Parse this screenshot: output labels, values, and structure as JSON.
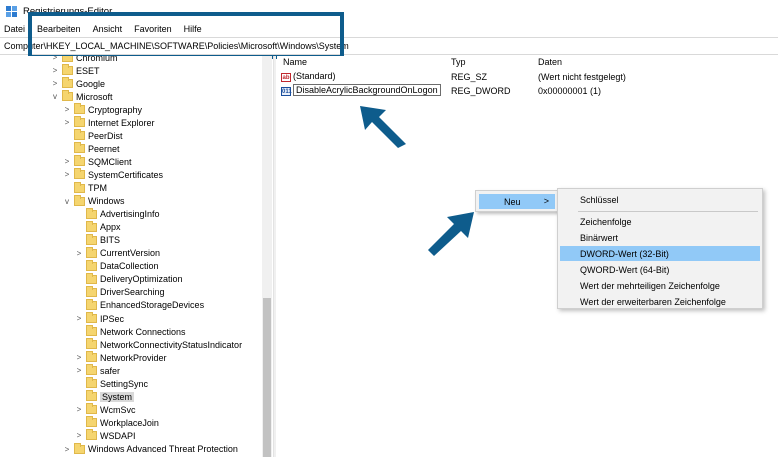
{
  "window": {
    "title": "Registrierungs-Editor"
  },
  "menubar": [
    "Datei",
    "Bearbeiten",
    "Ansicht",
    "Favoriten",
    "Hilfe"
  ],
  "address": {
    "path": "Computer\\HKEY_LOCAL_MACHINE\\SOFTWARE\\Policies\\Microsoft\\Windows\\System"
  },
  "tree": [
    {
      "label": "Chromium",
      "level": 1,
      "expand": ">"
    },
    {
      "label": "ESET",
      "level": 1,
      "expand": ">"
    },
    {
      "label": "Google",
      "level": 1,
      "expand": ">"
    },
    {
      "label": "Microsoft",
      "level": 1,
      "expand": "v"
    },
    {
      "label": "Cryptography",
      "level": 2,
      "expand": ">"
    },
    {
      "label": "Internet Explorer",
      "level": 2,
      "expand": ">"
    },
    {
      "label": "PeerDist",
      "level": 2,
      "expand": ""
    },
    {
      "label": "Peernet",
      "level": 2,
      "expand": ""
    },
    {
      "label": "SQMClient",
      "level": 2,
      "expand": ">"
    },
    {
      "label": "SystemCertificates",
      "level": 2,
      "expand": ">"
    },
    {
      "label": "TPM",
      "level": 2,
      "expand": ""
    },
    {
      "label": "Windows",
      "level": 2,
      "expand": "v"
    },
    {
      "label": "AdvertisingInfo",
      "level": 3,
      "expand": ""
    },
    {
      "label": "Appx",
      "level": 3,
      "expand": ""
    },
    {
      "label": "BITS",
      "level": 3,
      "expand": ""
    },
    {
      "label": "CurrentVersion",
      "level": 3,
      "expand": ">"
    },
    {
      "label": "DataCollection",
      "level": 3,
      "expand": ""
    },
    {
      "label": "DeliveryOptimization",
      "level": 3,
      "expand": ""
    },
    {
      "label": "DriverSearching",
      "level": 3,
      "expand": ""
    },
    {
      "label": "EnhancedStorageDevices",
      "level": 3,
      "expand": ""
    },
    {
      "label": "IPSec",
      "level": 3,
      "expand": ">"
    },
    {
      "label": "Network Connections",
      "level": 3,
      "expand": ""
    },
    {
      "label": "NetworkConnectivityStatusIndicator",
      "level": 3,
      "expand": ""
    },
    {
      "label": "NetworkProvider",
      "level": 3,
      "expand": ">"
    },
    {
      "label": "safer",
      "level": 3,
      "expand": ">"
    },
    {
      "label": "SettingSync",
      "level": 3,
      "expand": ""
    },
    {
      "label": "System",
      "level": 3,
      "expand": "",
      "selected": true
    },
    {
      "label": "WcmSvc",
      "level": 3,
      "expand": ">"
    },
    {
      "label": "WorkplaceJoin",
      "level": 3,
      "expand": ""
    },
    {
      "label": "WSDAPI",
      "level": 3,
      "expand": ">"
    },
    {
      "label": "Windows Advanced Threat Protection",
      "level": 2,
      "expand": ">"
    }
  ],
  "list": {
    "headers": {
      "name": "Name",
      "type": "Typ",
      "data": "Daten"
    },
    "rows": [
      {
        "icon": "ab",
        "name": "(Standard)",
        "type": "REG_SZ",
        "data": "(Wert nicht festgelegt)"
      },
      {
        "icon": "011",
        "name": "DisableAcrylicBackgroundOnLogon",
        "type": "REG_DWORD",
        "data": "0x00000001 (1)"
      }
    ]
  },
  "context_menu": {
    "neu": {
      "label": "Neu",
      "chevron": ">"
    },
    "submenu": [
      "Schlüssel",
      "Zeichenfolge",
      "Binärwert",
      "DWORD-Wert (32-Bit)",
      "QWORD-Wert (64-Bit)",
      "Wert der mehrteiligen Zeichenfolge",
      "Wert der erweiterbaren Zeichenfolge"
    ]
  },
  "colors": {
    "accent_box": "#0e5c8c",
    "menu_highlight": "#91c9f7"
  }
}
